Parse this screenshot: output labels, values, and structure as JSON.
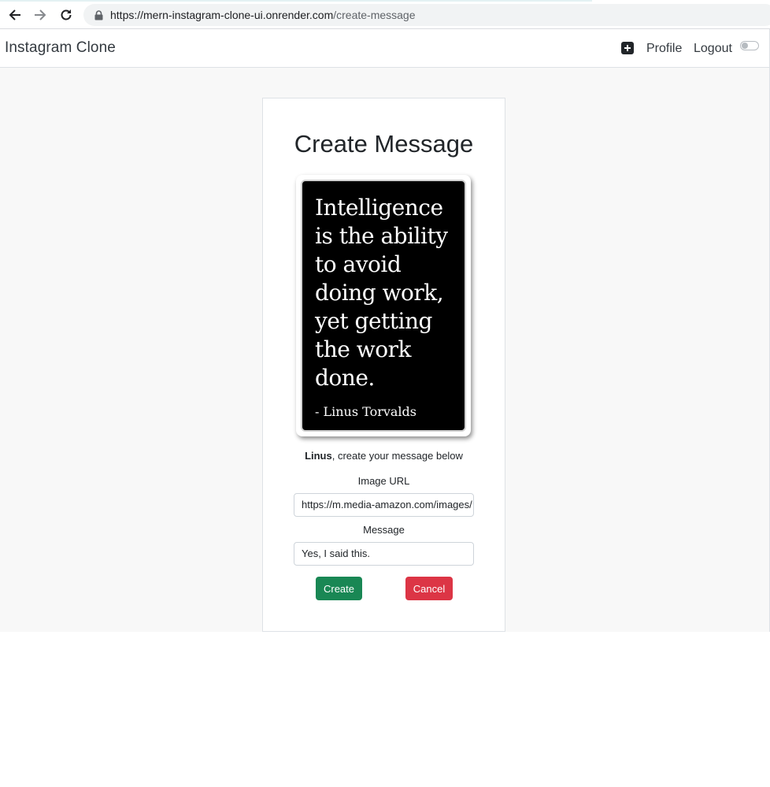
{
  "browser": {
    "url_host": "https://mern-instagram-clone-ui.onrender.com",
    "url_path": "/create-message"
  },
  "navbar": {
    "brand": "Instagram Clone",
    "profile_label": "Profile",
    "logout_label": "Logout",
    "create_icon": "plus-square-icon",
    "theme_toggle_on": false
  },
  "card": {
    "title": "Create Message",
    "image": {
      "quote": "Intelligence\nis the ability\nto avoid\ndoing work,\nyet getting\nthe work\ndone.",
      "author": "- Linus Torvalds"
    },
    "greeting_name": "Linus",
    "greeting_rest": ", create your message below",
    "image_url_label": "Image URL",
    "image_url_value": "https://m.media-amazon.com/images/",
    "message_label": "Message",
    "message_value": "Yes, I said this.",
    "create_label": "Create",
    "cancel_label": "Cancel"
  },
  "colors": {
    "create_button": "#198754",
    "cancel_button": "#dc3545",
    "page_background": "#f8f8f8"
  }
}
